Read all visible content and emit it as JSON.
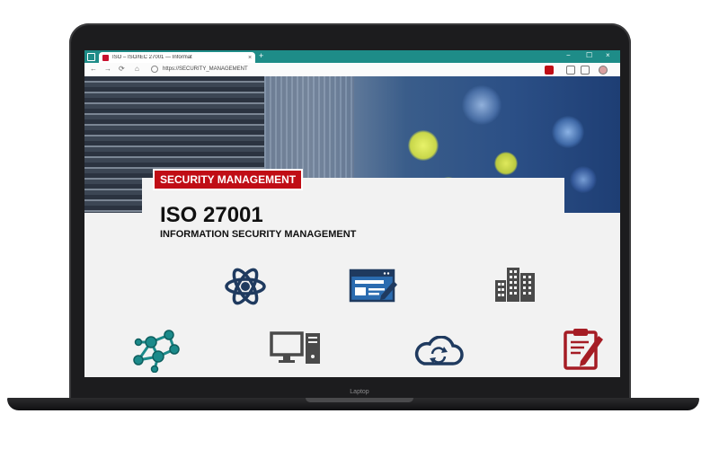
{
  "browser": {
    "tab_title": "ISO – ISO/IEC 27001 — Informat",
    "tab_close": "×",
    "new_tab": "+",
    "window_controls": [
      "−",
      "☐",
      "×"
    ],
    "url": "https://SECURITY_MANAGEMENT",
    "nav": [
      "←",
      "→",
      "⟳",
      "⌂"
    ]
  },
  "page": {
    "badge": "SECURITY MANAGEMENT",
    "title": "ISO 27001",
    "subtitle": "INFORMATION SECURITY MANAGEMENT"
  },
  "icons": [
    "atom-icon",
    "web-form-edit-icon",
    "buildings-icon",
    "network-nodes-icon",
    "desktop-computer-icon",
    "cloud-sync-icon",
    "clipboard-edit-icon"
  ],
  "colors": {
    "titlebar": "#1e8c88",
    "badge": "#c00d15",
    "icon_navy": "#1f3a5f",
    "icon_teal": "#1b8a8a",
    "icon_gray": "#4a4a4a",
    "icon_red": "#a51c24"
  },
  "device": {
    "label": "Laptop"
  }
}
